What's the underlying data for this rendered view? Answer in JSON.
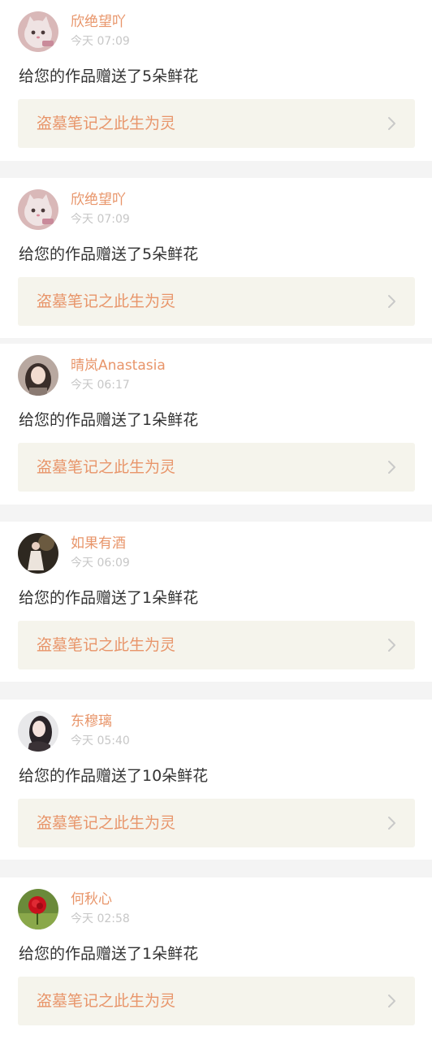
{
  "notifications": [
    {
      "user": "欣绝望吖",
      "time": "今天 07:09",
      "message": "给您的作品赠送了5朵鲜花",
      "work_title": "盗墓笔记之此生为灵",
      "avatar": "cat-avatar"
    },
    {
      "user": "欣绝望吖",
      "time": "今天 07:09",
      "message": "给您的作品赠送了5朵鲜花",
      "work_title": "盗墓笔记之此生为灵",
      "avatar": "cat-avatar"
    },
    {
      "user": "晴岚Anastasia",
      "time": "今天 06:17",
      "message": "给您的作品赠送了1朵鲜花",
      "work_title": "盗墓笔记之此生为灵",
      "avatar": "girl-avatar"
    },
    {
      "user": "如果有酒",
      "time": "今天 06:09",
      "message": "给您的作品赠送了1朵鲜花",
      "work_title": "盗墓笔记之此生为灵",
      "avatar": "dress-girl-avatar"
    },
    {
      "user": "东穆璃",
      "time": "今天 05:40",
      "message": "给您的作品赠送了10朵鲜花",
      "work_title": "盗墓笔记之此生为灵",
      "avatar": "portrait-avatar"
    },
    {
      "user": "何秋心",
      "time": "今天 02:58",
      "message": "给您的作品赠送了1朵鲜花",
      "work_title": "盗墓笔记之此生为灵",
      "avatar": "rose-avatar"
    }
  ],
  "colors": {
    "accent": "#e8956a",
    "link_bg": "#f5f4ec",
    "time": "#c7c7c7",
    "text": "#333333",
    "chevron": "#c9c9c9"
  },
  "icons": {
    "chevron": "chevron-right-icon"
  }
}
